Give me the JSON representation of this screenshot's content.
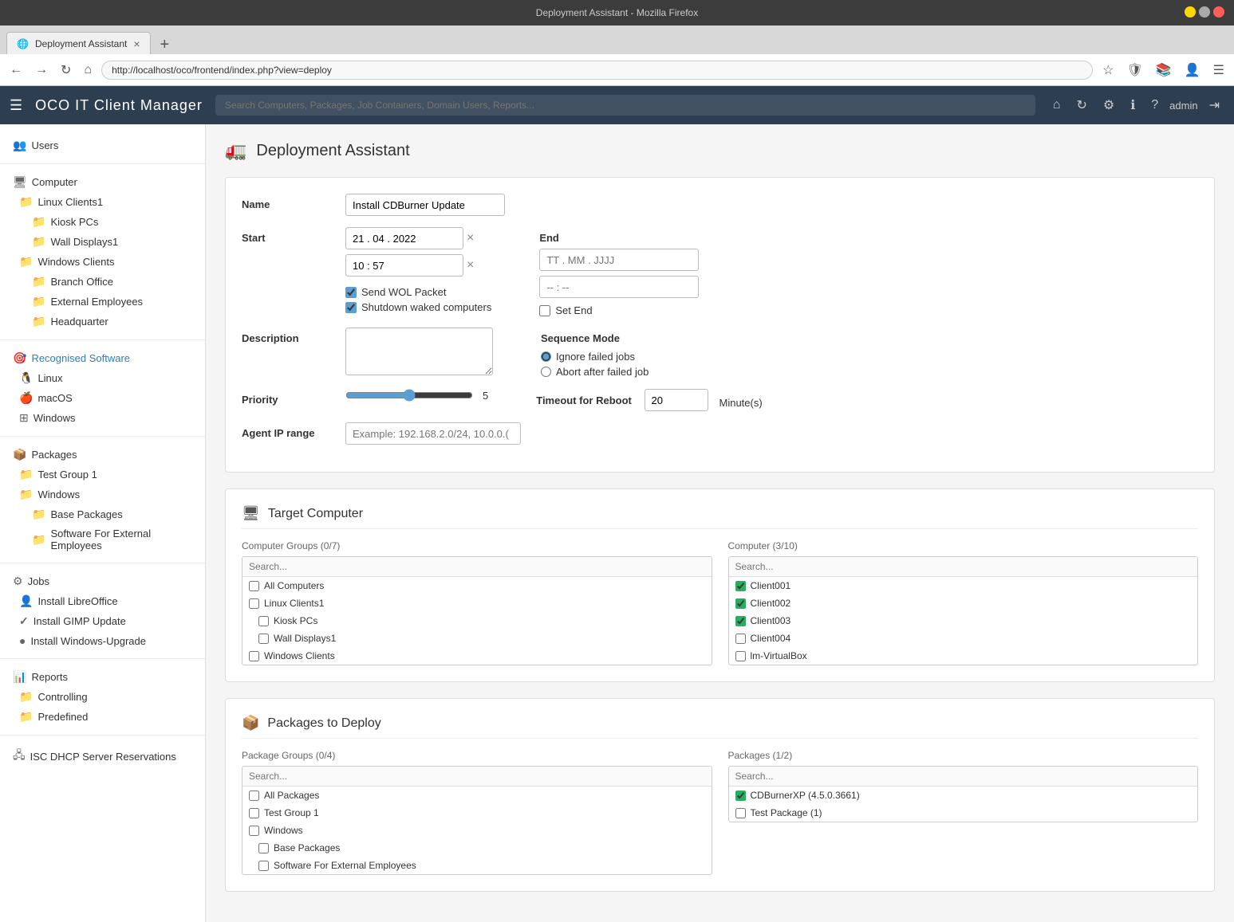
{
  "browser": {
    "title": "Deployment Assistant - Mozilla Firefox",
    "tab_label": "Deployment Assistant",
    "url": "http://localhost/oco/frontend/index.php?view=deploy",
    "nav_back": "←",
    "nav_forward": "→",
    "nav_refresh": "↻",
    "nav_home": "⌂"
  },
  "app": {
    "title": "OCO IT Client Manager",
    "search_placeholder": "Search Computers, Packages, Job Containers, Domain Users, Reports...",
    "username": "admin"
  },
  "sidebar": {
    "users_label": "Users",
    "computer_label": "Computer",
    "linux_clients1": "Linux Clients1",
    "kiosk_pcs": "Kiosk PCs",
    "wall_displays1": "Wall Displays1",
    "windows_clients": "Windows Clients",
    "branch_office": "Branch Office",
    "external_employees": "External Employees",
    "headquarter": "Headquarter",
    "recognised_software": "Recognised Software",
    "linux": "Linux",
    "macos": "macOS",
    "windows": "Windows",
    "packages": "Packages",
    "test_group1": "Test Group 1",
    "windows_pkg": "Windows",
    "base_packages": "Base Packages",
    "software_external": "Software For External Employees",
    "jobs": "Jobs",
    "install_libreoffice": "Install LibreOffice",
    "install_gimp": "Install GIMP Update",
    "install_windows_upgrade": "Install Windows-Upgrade",
    "reports": "Reports",
    "controlling": "Controlling",
    "predefined": "Predefined",
    "isc_dhcp": "ISC DHCP Server Reservations"
  },
  "page": {
    "icon": "🚛",
    "title": "Deployment Assistant",
    "form": {
      "name_label": "Name",
      "name_value": "Install CDBurner Update",
      "start_label": "Start",
      "start_date": "21 . 04 . 2022",
      "start_time": "10 : 57",
      "send_wol": true,
      "send_wol_label": "Send WOL Packet",
      "shutdown_waked": true,
      "shutdown_waked_label": "Shutdown waked computers",
      "end_label": "End",
      "end_date_placeholder": "TT . MM . JJJJ",
      "end_time_placeholder": "-- : --",
      "set_end_label": "Set End",
      "description_label": "Description",
      "description_value": "",
      "sequence_label": "Sequence Mode",
      "ignore_failed": "Ignore failed jobs",
      "abort_failed": "Abort after failed job",
      "priority_label": "Priority",
      "priority_value": 5,
      "priority_max": 10,
      "timeout_label": "Timeout for Reboot",
      "timeout_value": "20",
      "timeout_unit": "Minute(s)",
      "agent_ip_label": "Agent IP range",
      "agent_ip_placeholder": "Example: 192.168.2.0/24, 10.0.0.(",
      "agent_ip_value": ""
    },
    "target_computer": {
      "section_icon": "🖥",
      "section_title": "Target Computer",
      "groups_label": "Computer Groups (0/7)",
      "computers_label": "Computer (3/10)",
      "groups_search_placeholder": "Search...",
      "computers_search_placeholder": "Search...",
      "groups": [
        {
          "label": "All Computers",
          "checked": false,
          "indent": 0
        },
        {
          "label": "Linux Clients1",
          "checked": false,
          "indent": 0
        },
        {
          "label": "Kiosk PCs",
          "checked": false,
          "indent": 1
        },
        {
          "label": "Wall Displays1",
          "checked": false,
          "indent": 1
        },
        {
          "label": "Windows Clients",
          "checked": false,
          "indent": 0
        }
      ],
      "computers": [
        {
          "label": "Client001",
          "checked": true,
          "indent": 0
        },
        {
          "label": "Client002",
          "checked": true,
          "indent": 0
        },
        {
          "label": "Client003",
          "checked": true,
          "indent": 0
        },
        {
          "label": "Client004",
          "checked": false,
          "indent": 0
        },
        {
          "label": "lm-VirtualBox",
          "checked": false,
          "indent": 0
        }
      ]
    },
    "packages_to_deploy": {
      "section_icon": "📦",
      "section_title": "Packages to Deploy",
      "groups_label": "Package Groups (0/4)",
      "packages_label": "Packages (1/2)",
      "groups_search_placeholder": "Search...",
      "packages_search_placeholder": "Search...",
      "groups": [
        {
          "label": "All Packages",
          "checked": false,
          "indent": 0
        },
        {
          "label": "Test Group 1",
          "checked": false,
          "indent": 0
        },
        {
          "label": "Windows",
          "checked": false,
          "indent": 0
        },
        {
          "label": "Base Packages",
          "checked": false,
          "indent": 1
        },
        {
          "label": "Software For External Employees",
          "checked": false,
          "indent": 1
        }
      ],
      "packages": [
        {
          "label": "CDBurnerXP (4.5.0.3661)",
          "checked": true,
          "indent": 0
        },
        {
          "label": "Test Package (1)",
          "checked": false,
          "indent": 0
        }
      ]
    }
  }
}
